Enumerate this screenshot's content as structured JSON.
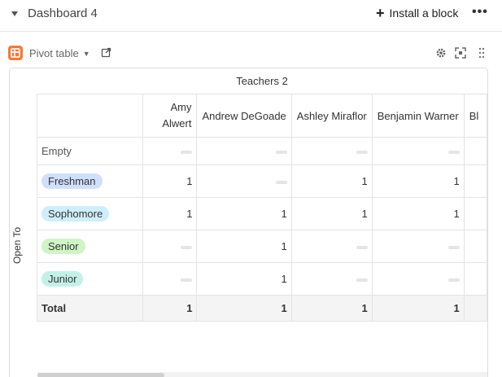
{
  "dashboard": {
    "title": "Dashboard 4",
    "install_label": "Install a block",
    "more_label": "•••"
  },
  "block": {
    "name": "Pivot table",
    "icon_names": [
      "pivot-app-icon",
      "open-external-icon",
      "gear-icon",
      "expand-icon",
      "drag-handle-icon"
    ],
    "logo_color": "#f37b38"
  },
  "pivot": {
    "column_field": "Teachers 2",
    "row_field": "Open To",
    "columns": [
      "Amy Alwert",
      "Andrew DeGoade",
      "Ashley Miraflor",
      "Benjamin Warner",
      "Bl"
    ],
    "rows": [
      {
        "label": "Empty",
        "kind": "text",
        "color": "",
        "values": [
          "",
          "",
          "",
          "",
          ""
        ]
      },
      {
        "label": "Freshman",
        "kind": "pill",
        "color": "#d0dffc",
        "values": [
          "1",
          "",
          "1",
          "1",
          ""
        ]
      },
      {
        "label": "Sophomore",
        "kind": "pill",
        "color": "#cfeefc",
        "values": [
          "1",
          "1",
          "1",
          "1",
          ""
        ]
      },
      {
        "label": "Senior",
        "kind": "pill",
        "color": "#d1f4c6",
        "values": [
          "",
          "1",
          "",
          "",
          ""
        ]
      },
      {
        "label": "Junior",
        "kind": "pill",
        "color": "#c4f0e8",
        "values": [
          "",
          "1",
          "",
          "",
          ""
        ]
      }
    ],
    "total": {
      "label": "Total",
      "values": [
        "1",
        "1",
        "1",
        "1",
        ""
      ]
    }
  }
}
